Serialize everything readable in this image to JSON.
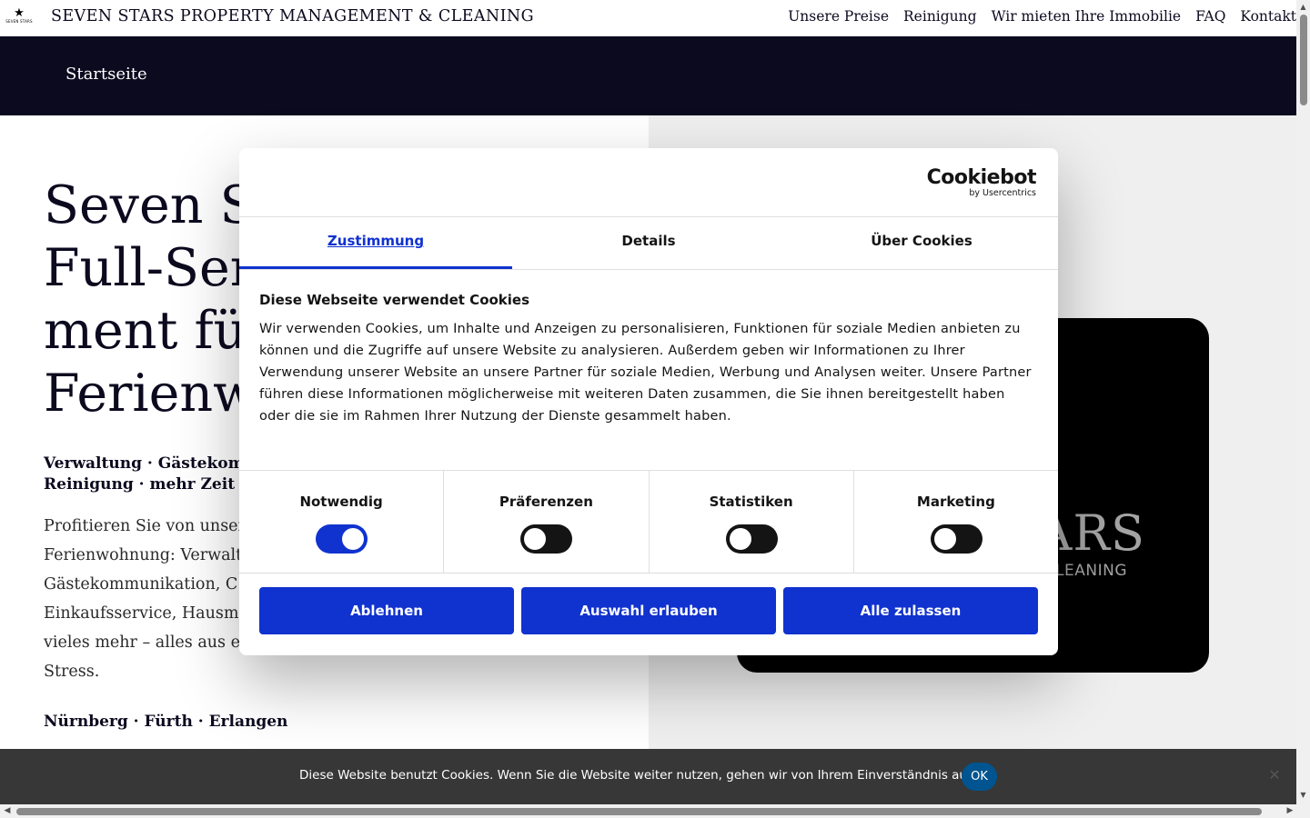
{
  "header": {
    "logo_text": "SEVEN STARS",
    "brand": "SEVEN STARS PROPERTY MANAGEMENT & CLEANING",
    "nav": [
      "Unsere Preise",
      "Reinigung",
      "Wir mieten Ihre Immobilie",
      "FAQ",
      "Kontakt"
    ]
  },
  "subnav": {
    "home": "Startseite"
  },
  "hero": {
    "title_lines": [
      "Seven Sta",
      "Full-Serv",
      "ment für",
      "Ferienwo"
    ],
    "subtitle_lines": [
      "Verwaltung · Gästekomm",
      "Reinigung · mehr Zeit & m"
    ],
    "body_lines": [
      "Profitieren Sie von unser",
      "Ferienwohnung: Verwalt",
      "Gästekommunikation, C",
      "Einkaufsservice, Hausm",
      "vieles mehr – alles aus e",
      "Stress."
    ],
    "cities": "Nürnberg · Fürth · Erlangen",
    "card_big": "ARS",
    "card_small": "LEANING"
  },
  "cookiebot": {
    "logo_main": "Cookiebot",
    "logo_sub": "by Usercentrics",
    "tabs": [
      {
        "label": "Zustimmung",
        "active": true
      },
      {
        "label": "Details",
        "active": false
      },
      {
        "label": "Über Cookies",
        "active": false
      }
    ],
    "title": "Diese Webseite verwendet Cookies",
    "text": "Wir verwenden Cookies, um Inhalte und Anzeigen zu personalisieren, Funktionen für soziale Medien anbieten zu können und die Zugriffe auf unsere Website zu analysieren. Außerdem geben wir Informationen zu Ihrer Verwendung unserer Website an unsere Partner für soziale Medien, Werbung und Analysen weiter. Unsere Partner führen diese Informationen möglicherweise mit weiteren Daten zusammen, die Sie ihnen bereitgestellt haben oder die sie im Rahmen Ihrer Nutzung der Dienste gesammelt haben.",
    "categories": [
      {
        "label": "Notwendig",
        "enabled": true
      },
      {
        "label": "Präferenzen",
        "enabled": false
      },
      {
        "label": "Statistiken",
        "enabled": false
      },
      {
        "label": "Marketing",
        "enabled": false
      }
    ],
    "buttons": {
      "decline": "Ablehnen",
      "allow_selection": "Auswahl erlauben",
      "allow_all": "Alle zulassen"
    }
  },
  "notice": {
    "text": "Diese Website benutzt Cookies. Wenn Sie die Website weiter nutzen, gehen wir von Ihrem Einverständnis aus.",
    "ok": "OK",
    "close": "✕"
  },
  "colors": {
    "navy": "#0c0a1f",
    "cookiebot_blue": "#1032cf",
    "notice_bg": "#282828",
    "ok_button": "#00548f",
    "hero_right_bg": "#efefef"
  }
}
